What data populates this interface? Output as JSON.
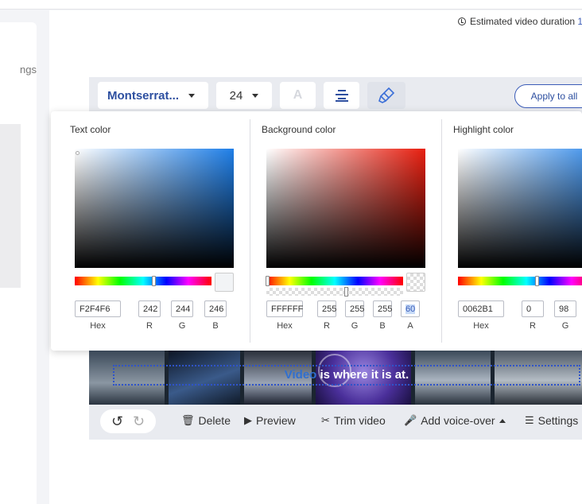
{
  "left_panel": {
    "label_fragment": "ngs"
  },
  "header": {
    "duration_label": "Estimated video duration",
    "duration_value": "1"
  },
  "toolbar": {
    "font": "Montserrat...",
    "font_size": "24",
    "text_style_letter": "A",
    "apply_to_all": "Apply to all",
    "icons": {
      "align": "align-center-icon",
      "highlight": "marker-icon"
    }
  },
  "color_pickers": [
    {
      "title": "Text color",
      "hex": "F2F4F6",
      "r": "242",
      "g": "244",
      "b": "246",
      "hue_color": "#1f7fe8",
      "swatch": "#F2F4F6"
    },
    {
      "title": "Background color",
      "hex": "FFFFFF",
      "r": "255",
      "g": "255",
      "b": "255",
      "a": "60",
      "hue_color": "#e81f10",
      "swatch": "transparent"
    },
    {
      "title": "Highlight color",
      "hex": "0062B1",
      "r": "0",
      "g": "98",
      "hue_color": "#1f7fe8",
      "swatch": "#0062B1"
    }
  ],
  "field_labels": {
    "hex": "Hex",
    "r": "R",
    "g": "G",
    "b": "B",
    "a": "A"
  },
  "video": {
    "caption_highlight": "Video",
    "caption_rest": " is where it is at."
  },
  "bottom_bar": {
    "delete": "Delete",
    "preview": "Preview",
    "trim": "Trim video",
    "voice": "Add voice-over",
    "settings": "Settings"
  }
}
